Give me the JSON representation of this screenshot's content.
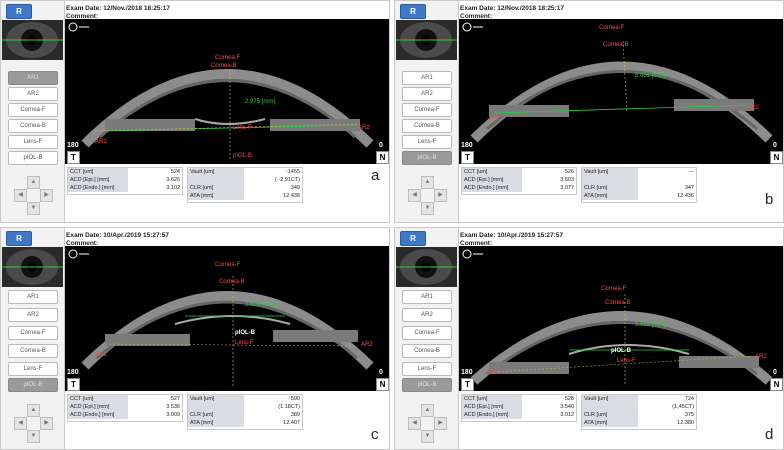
{
  "panels": [
    {
      "letter": "a",
      "exam_date": "Exam Date: 12/Nov./2018 18:25:17",
      "comment": "Comment:",
      "eye_label": "R",
      "side_buttons": [
        "AR1",
        "AR2",
        "Cornea-F",
        "Cornea-B",
        "Lens-F",
        "pIOL-B"
      ],
      "scan_labels": {
        "cornea_f": "Cornea-F",
        "cornea_b": "Cornea-B",
        "ar1": "AR1",
        "ar2": "AR2",
        "iol": "pIOL-B",
        "lens": "Lens-F",
        "measure": "2.975 [mm]"
      },
      "deg_left": "180",
      "deg_right": "0",
      "side_t": "T",
      "side_n": "N",
      "left_table": [
        {
          "k": "CCT [um]",
          "v": "524"
        },
        {
          "k": "ACD [Epi.] [mm]",
          "v": "3.626"
        },
        {
          "k": "ACD [Endo.] [mm]",
          "v": "3.102"
        }
      ],
      "right_table": [
        {
          "k": "Vault [um]",
          "v": "-1455"
        },
        {
          "k": "",
          "v": "( -2.91CT)"
        },
        {
          "k": "CLR [um]",
          "v": "349"
        },
        {
          "k": "ATA [mm]",
          "v": "12.438"
        }
      ]
    },
    {
      "letter": "b",
      "exam_date": "Exam Date: 12/Nov./2018 18:25:17",
      "comment": "Comment:",
      "eye_label": "R",
      "side_buttons": [
        "AR1",
        "AR2",
        "Cornea-F",
        "Cornea-B",
        "Lens-F",
        "pIOL-B"
      ],
      "scan_labels": {
        "cornea_f": "Cornea-F",
        "cornea_b": "Cornea-B",
        "ar1": "AR1",
        "ar2": "AR2",
        "iol": "",
        "lens": "",
        "measure": "5.051 [mm]"
      },
      "deg_left": "180",
      "deg_right": "0",
      "side_t": "T",
      "side_n": "N",
      "left_table": [
        {
          "k": "CCT [um]",
          "v": "526"
        },
        {
          "k": "ACD [Epi.] [mm]",
          "v": "3.603"
        },
        {
          "k": "ACD [Endo.] [mm]",
          "v": "3.077"
        }
      ],
      "right_table": [
        {
          "k": "Vault [um]",
          "v": "---"
        },
        {
          "k": "",
          "v": ""
        },
        {
          "k": "CLR [um]",
          "v": "347"
        },
        {
          "k": "ATA [mm]",
          "v": "12.436"
        }
      ]
    },
    {
      "letter": "c",
      "exam_date": "Exam Date: 10/Apr./2019 15:27:57",
      "comment": "Comment:",
      "eye_label": "R",
      "side_buttons": [
        "AR1",
        "AR2",
        "Cornea-F",
        "Cornea-B",
        "Lens-F",
        "pIOL-B"
      ],
      "scan_labels": {
        "cornea_f": "Cornea-F",
        "cornea_b": "Cornea-B",
        "ar1": "AR1",
        "ar2": "AR2",
        "iol": "pIOL-B",
        "lens": "Lens-F",
        "measure": "3.699 [mm]"
      },
      "deg_left": "180",
      "deg_right": "0",
      "side_t": "T",
      "side_n": "N",
      "left_table": [
        {
          "k": "CCT [um]",
          "v": "527"
        },
        {
          "k": "ACD [Epi.] [mm]",
          "v": "3.536"
        },
        {
          "k": "ACD [Endo.] [mm]",
          "v": "3.009"
        }
      ],
      "right_table": [
        {
          "k": "Vault [um]",
          "v": "590"
        },
        {
          "k": "",
          "v": "(1.18CT)"
        },
        {
          "k": "CLR [um]",
          "v": "389"
        },
        {
          "k": "ATA [mm]",
          "v": "12.407"
        }
      ]
    },
    {
      "letter": "d",
      "exam_date": "Exam Date: 10/Apr./2019 15:27:57",
      "comment": "Comment:",
      "eye_label": "R",
      "side_buttons": [
        "AR1",
        "AR2",
        "Cornea-F",
        "Cornea-B",
        "Lens-F",
        "pIOL-B"
      ],
      "scan_labels": {
        "cornea_f": "Cornea-F",
        "cornea_b": "Cornea-B",
        "ar1": "AR1",
        "ar2": "AR2",
        "iol": "pIOL-B",
        "lens": "Lens-F",
        "measure": "5.958 [mm]"
      },
      "deg_left": "180",
      "deg_right": "0",
      "side_t": "T",
      "side_n": "N",
      "left_table": [
        {
          "k": "CCT [um]",
          "v": "528"
        },
        {
          "k": "ACD [Epi.] [mm]",
          "v": "3.540"
        },
        {
          "k": "ACD [Endo.] [mm]",
          "v": "3.012"
        }
      ],
      "right_table": [
        {
          "k": "Vault [um]",
          "v": "724"
        },
        {
          "k": "",
          "v": "(1.45CT)"
        },
        {
          "k": "CLR [um]",
          "v": "375"
        },
        {
          "k": "ATA [mm]",
          "v": "12.380"
        }
      ]
    }
  ]
}
